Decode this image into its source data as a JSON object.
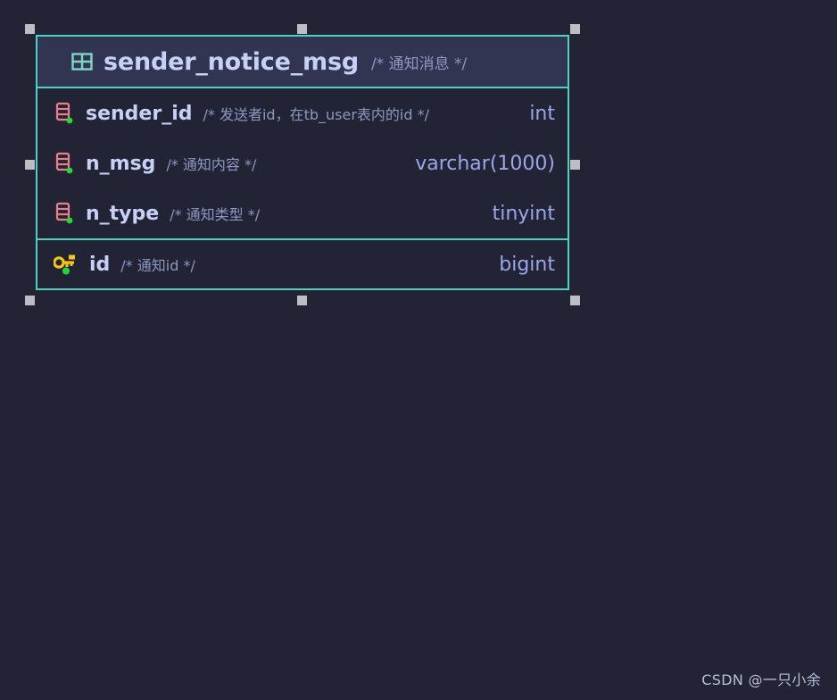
{
  "canvas": {
    "background_color": "#222436",
    "accent_color": "#4fd1c0",
    "handle_color": "#bdbdc4"
  },
  "entity": {
    "icon": "table-icon",
    "name": "sender_notice_msg",
    "comment": "/* 通知消息 */",
    "header_background": "#313552",
    "border_color": "#4fd1c0",
    "columns": [
      {
        "icon": "column-icon",
        "name": "sender_id",
        "comment": "/* 发送者id，在tb_user表内的id */",
        "type": "int",
        "primary_key": false,
        "not_null": true
      },
      {
        "icon": "column-icon",
        "name": "n_msg",
        "comment": "/* 通知内容 */",
        "type": "varchar(1000)",
        "primary_key": false,
        "not_null": true
      },
      {
        "icon": "column-icon",
        "name": "n_type",
        "comment": "/* 通知类型 */",
        "type": "tinyint",
        "primary_key": false,
        "not_null": true
      }
    ],
    "primary_key_columns": [
      {
        "icon": "key-icon",
        "name": "id",
        "comment": "/* 通知id */",
        "type": "bigint",
        "primary_key": true,
        "not_null": true
      }
    ]
  },
  "selection_handles": [
    "top-left",
    "top-center",
    "top-right",
    "middle-left",
    "middle-right",
    "bottom-left",
    "bottom-center",
    "bottom-right"
  ],
  "watermark": {
    "text": "CSDN @一只小余"
  }
}
